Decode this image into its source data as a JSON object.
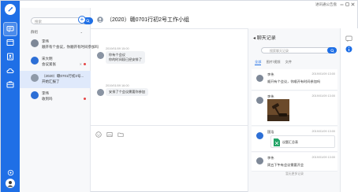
{
  "window": {
    "user_menu": "进讯通公告盘"
  },
  "search": {
    "placeholder": "搜索"
  },
  "conversation_list": {
    "group_label": "群组",
    "items": [
      {
        "name": "李伟",
        "message": "顺开有个会议，你顺开有时间参加吗",
        "time": "",
        "muted": false,
        "unread": false,
        "selected": false
      },
      {
        "name": "宋大明",
        "message": "会议紧张",
        "time": "",
        "muted": true,
        "unread": true,
        "selected": false
      },
      {
        "name": "（2020）赣0701行初2号...",
        "message": "开始汇报了",
        "time": "",
        "muted": false,
        "unread": false,
        "selected": true
      },
      {
        "name": "李伟",
        "message": "收到吗",
        "time": "",
        "muted": false,
        "unread": true,
        "selected": false
      }
    ]
  },
  "chat": {
    "title": "（2020）赣0701行初2号工作小组",
    "messages": [
      {
        "time": "2019/01/09 15:00",
        "lines": [
          "你有个会议",
          "你的时间段已经安排了"
        ]
      },
      {
        "time": "2019/01/09 16:00",
        "lines": [
          "安排了个会议需要你参加"
        ]
      }
    ]
  },
  "history": {
    "title": "聊天记录",
    "search_placeholder": "搜索聊天记录",
    "tabs": [
      "全部",
      "图片/视频",
      "文件"
    ],
    "active_tab": 0,
    "cards": [
      {
        "name": "李伟",
        "time": "2019/01/09 13:00",
        "text": "顺开有个会议，你顺开有时间参加吗"
      },
      {
        "name": "李伟",
        "time": "2019/01/09 13:00",
        "text": ""
      },
      {
        "name": "国浩",
        "time": "2019/01/09 13:00",
        "text": "",
        "file_name": "议题汇总表"
      },
      {
        "name": "李伟",
        "time": "2019/01/09 13:00",
        "text": "周五下午有会议需要开会"
      }
    ],
    "no_more": "暂无更多记录"
  },
  "colors": {
    "accent": "#1f6fe6",
    "unread": "#e54545",
    "selected_row": "#dfe9fb"
  }
}
